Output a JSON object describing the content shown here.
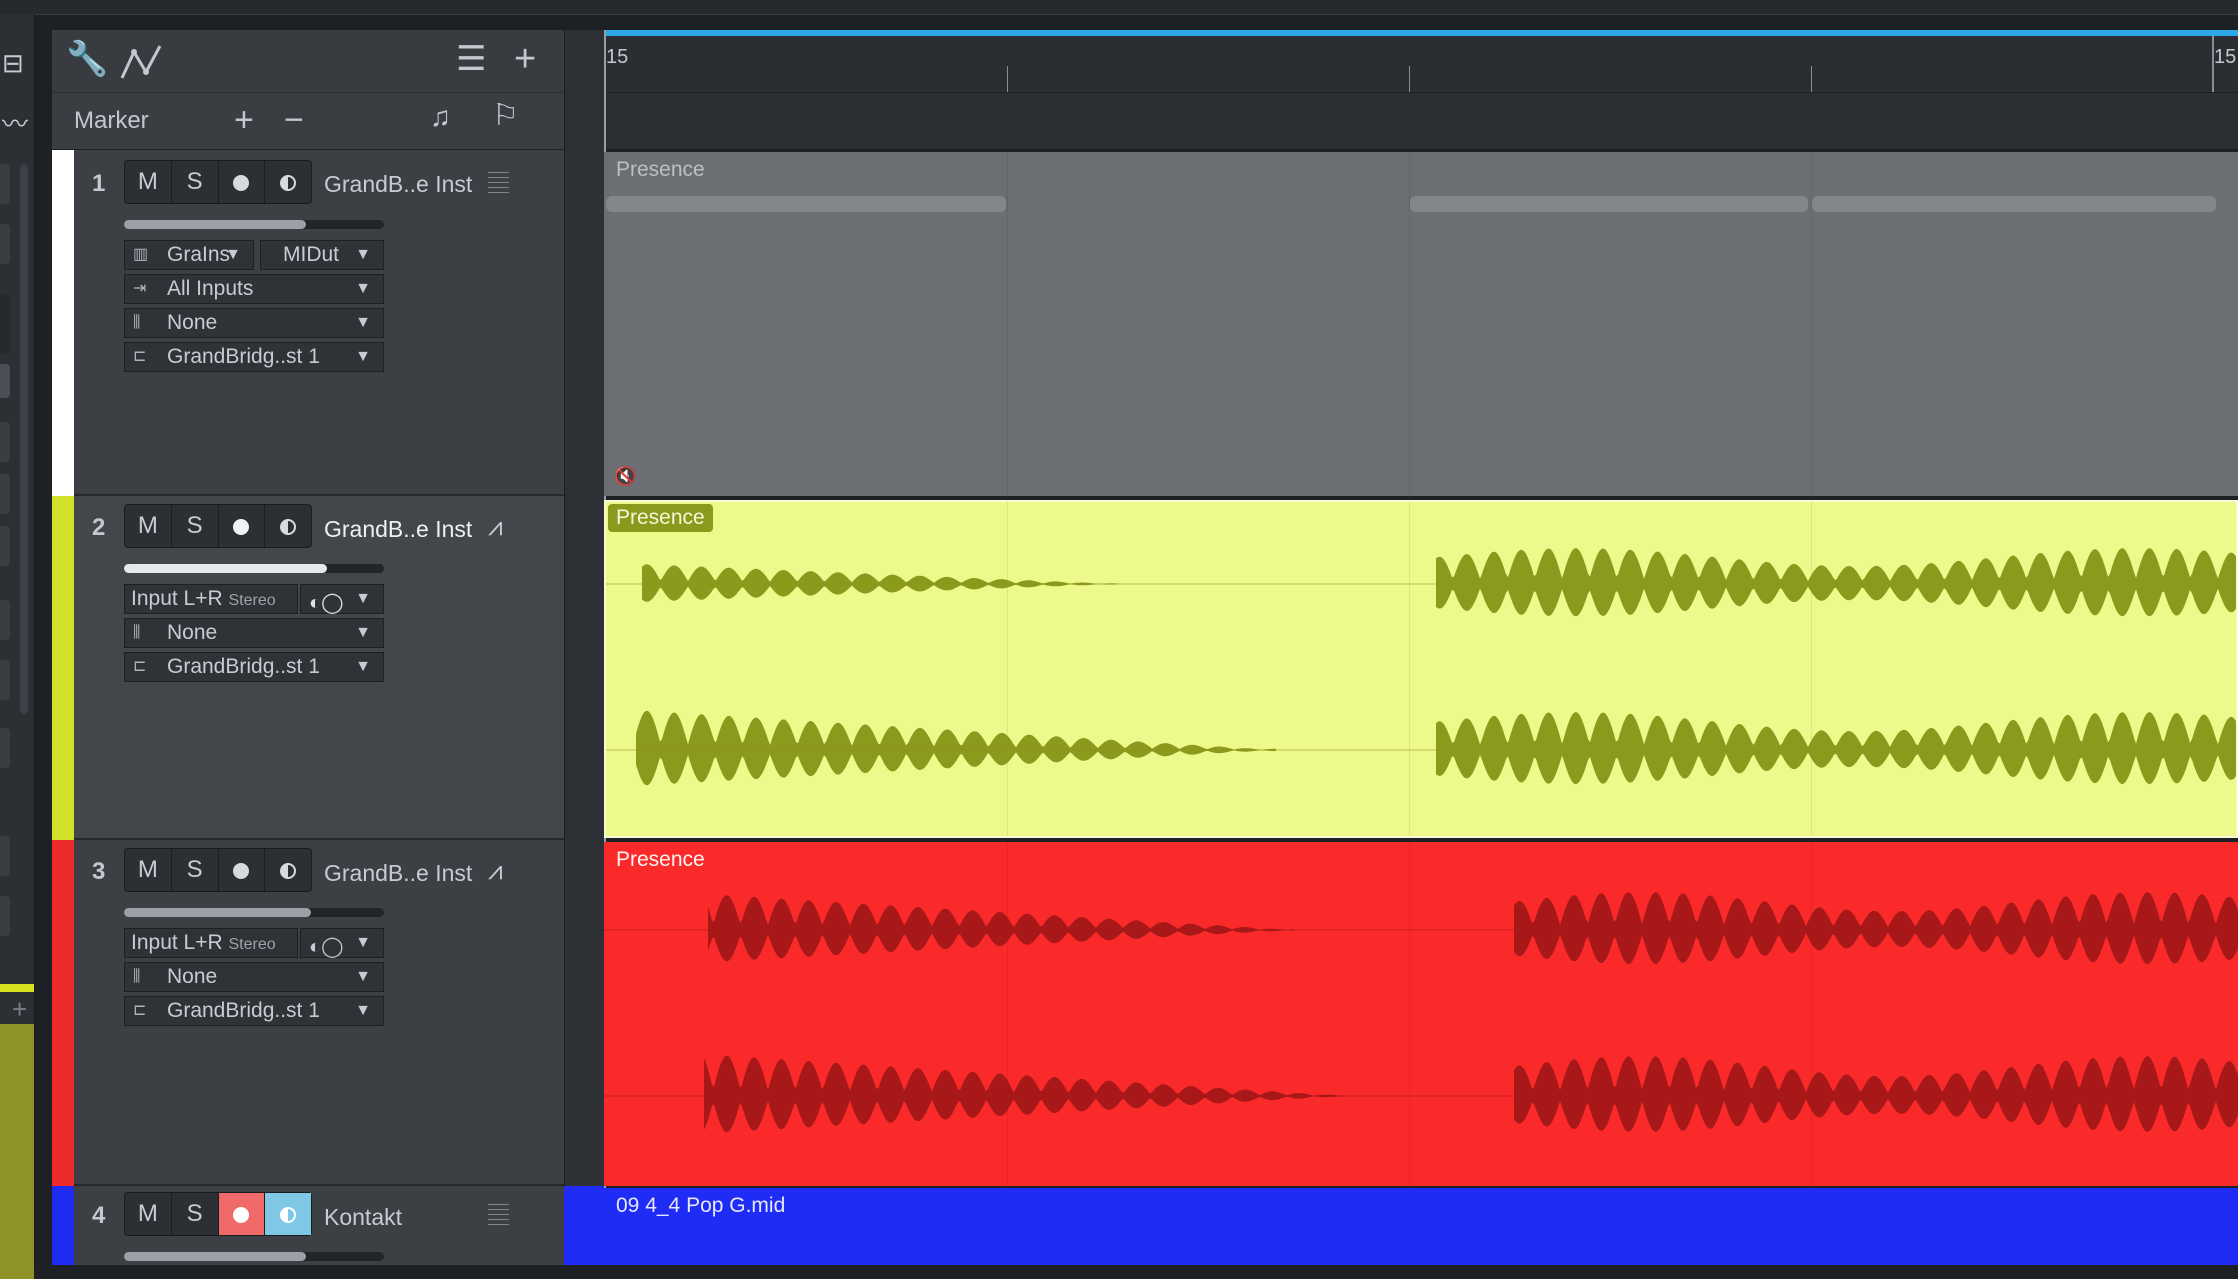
{
  "toolbar": {
    "marker_label": "Marker",
    "icons": [
      "wrench-icon",
      "automation-icon",
      "list-icon",
      "add-icon",
      "plus-icon",
      "minus-icon",
      "note-icon",
      "flag-icon"
    ]
  },
  "ruler": {
    "start_label": "15",
    "end_label": "15"
  },
  "tracks": [
    {
      "number": "1",
      "name": "GrandB..e Inst",
      "type_icon": "piano-icon",
      "color": "#ffffff",
      "buttons": {
        "mute": "M",
        "solo": "S"
      },
      "volume_level": 0.7,
      "fields": {
        "instrument": "GraIns",
        "midi_out": "MIDut",
        "input": "All Inputs",
        "bus": "None",
        "output": "GrandBridg..st 1"
      },
      "region": {
        "label": "Presence",
        "color": "#6b6e72",
        "muted": true
      }
    },
    {
      "number": "2",
      "name": "GrandB..e Inst",
      "type_icon": "waveform-icon",
      "color": "#d2e12a",
      "buttons": {
        "mute": "M",
        "solo": "S"
      },
      "volume_level": 0.78,
      "fields": {
        "input": "Input L+R",
        "input_format": "Stereo",
        "bus": "None",
        "output": "GrandBridg..st 1"
      },
      "region": {
        "label": "Presence",
        "color": "#eef98c",
        "wave_color": "#8b991c"
      }
    },
    {
      "number": "3",
      "name": "GrandB..e Inst",
      "type_icon": "waveform-icon",
      "color": "#ee2b2b",
      "buttons": {
        "mute": "M",
        "solo": "S"
      },
      "volume_level": 0.72,
      "fields": {
        "input": "Input L+R",
        "input_format": "Stereo",
        "bus": "None",
        "output": "GrandBridg..st 1"
      },
      "region": {
        "label": "Presence",
        "color": "#fb2a2a",
        "wave_color": "#a81818"
      }
    },
    {
      "number": "4",
      "name": "Kontakt",
      "type_icon": "piano-icon",
      "color": "#1f2cf0",
      "buttons": {
        "mute": "M",
        "solo": "S"
      },
      "volume_level": 0.7,
      "region": {
        "label": "09 4_4 Pop G.mid",
        "color": "#1f2cf5"
      }
    }
  ]
}
